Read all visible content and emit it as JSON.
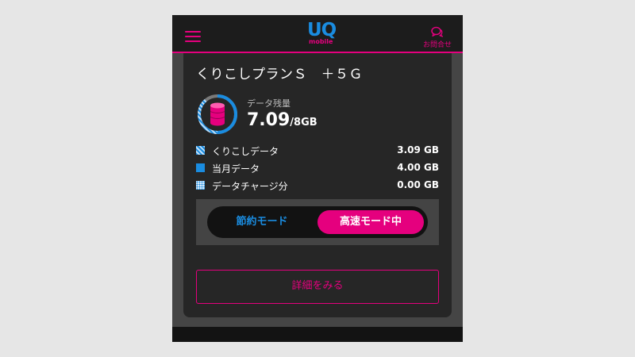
{
  "header": {
    "logo_main": "UQ",
    "logo_sub": "mobile",
    "contact_label": "お問合せ"
  },
  "plan": {
    "name": "くりこしプランＳ　＋５Ｇ"
  },
  "data_remaining": {
    "label": "データ残量",
    "value": "7.09",
    "total": "/8GB",
    "fraction": 0.886
  },
  "breakdown": [
    {
      "label": "くりこしデータ",
      "value": "3.09 GB"
    },
    {
      "label": "当月データ",
      "value": "4.00 GB"
    },
    {
      "label": "データチャージ分",
      "value": "0.00 GB"
    }
  ],
  "mode": {
    "saving_label": "節約モード",
    "fast_label": "高速モード中",
    "active": "fast"
  },
  "details_button": "詳細をみる",
  "colors": {
    "accent": "#e5007e",
    "brand_blue": "#1a8ce0",
    "background": "#131313",
    "card": "#262626"
  },
  "icons": {
    "menu": "hamburger-icon",
    "contact": "chat-bubbles-icon",
    "data": "database-icon"
  }
}
